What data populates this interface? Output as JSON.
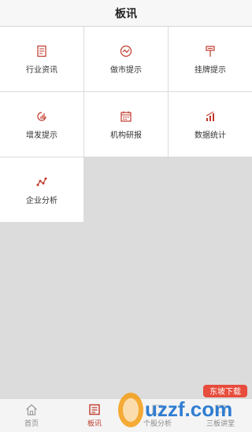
{
  "header": {
    "title": "板讯"
  },
  "grid": {
    "items": [
      {
        "label": "行业资讯",
        "icon": "document-icon"
      },
      {
        "label": "做市提示",
        "icon": "trend-circle-icon"
      },
      {
        "label": "挂牌提示",
        "icon": "signpost-icon"
      },
      {
        "label": "增发提示",
        "icon": "growth-circle-icon"
      },
      {
        "label": "机构研报",
        "icon": "calendar-icon"
      },
      {
        "label": "数据统计",
        "icon": "bar-chart-icon"
      },
      {
        "label": "企业分析",
        "icon": "line-nodes-icon"
      }
    ]
  },
  "tabbar": {
    "items": [
      {
        "label": "首页",
        "icon": "home-icon"
      },
      {
        "label": "板讯",
        "icon": "news-icon",
        "active": true
      },
      {
        "label": "个股分析",
        "icon": "analysis-icon"
      },
      {
        "label": "三板讲堂",
        "icon": "lecture-icon"
      }
    ]
  },
  "watermark": {
    "text": "uzzf.com",
    "badge": "东坡下载"
  },
  "colors": {
    "accent": "#c0392b",
    "background": "#dcdcdc",
    "card": "#ffffff"
  }
}
